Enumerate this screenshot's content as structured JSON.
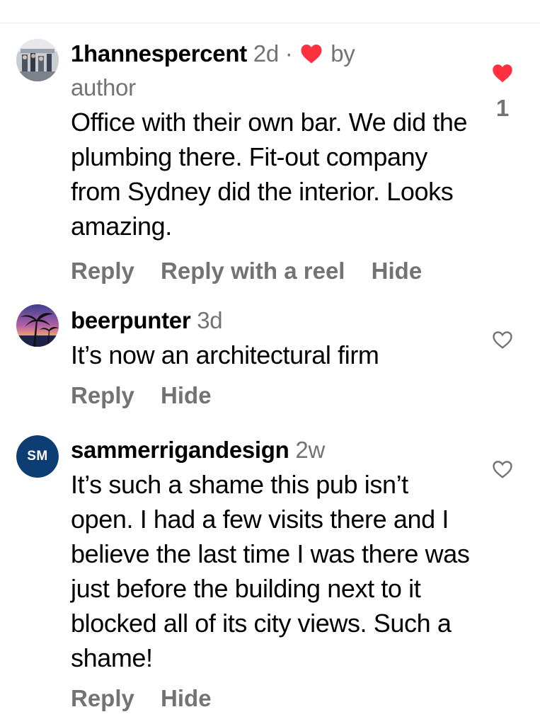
{
  "comments": [
    {
      "username": "1hannespercent",
      "time": "2d",
      "separator": "·",
      "liked_by_author": "by",
      "liked_by_author_line2": "author",
      "text": "Office with their own bar. We did the plumbing there. Fit-out company from Sydney did the interior. Looks amazing.",
      "actions": [
        "Reply",
        "Reply with a reel",
        "Hide"
      ],
      "liked": true,
      "like_count": "1"
    },
    {
      "username": "beerpunter",
      "time": "3d",
      "text": "It’s now an architectural firm",
      "actions": [
        "Reply",
        "Hide"
      ],
      "liked": false,
      "like_count": ""
    },
    {
      "username": "sammerrigandesign",
      "time": "2w",
      "avatar_initials": "SM",
      "text": "It’s such a shame this pub isn’t open. I had a few visits there and I believe the last time I was there was just before the building next to it blocked all of its city views. Such a shame!",
      "actions": [
        "Reply",
        "Hide"
      ],
      "liked": false,
      "like_count": ""
    }
  ],
  "icons": {
    "liked_heart": "heart-filled-icon",
    "unliked_heart": "heart-outline-icon"
  },
  "colors": {
    "like_red": "#ff3040",
    "secondary_text": "#737373",
    "avatar_navy": "#0c3d73"
  }
}
